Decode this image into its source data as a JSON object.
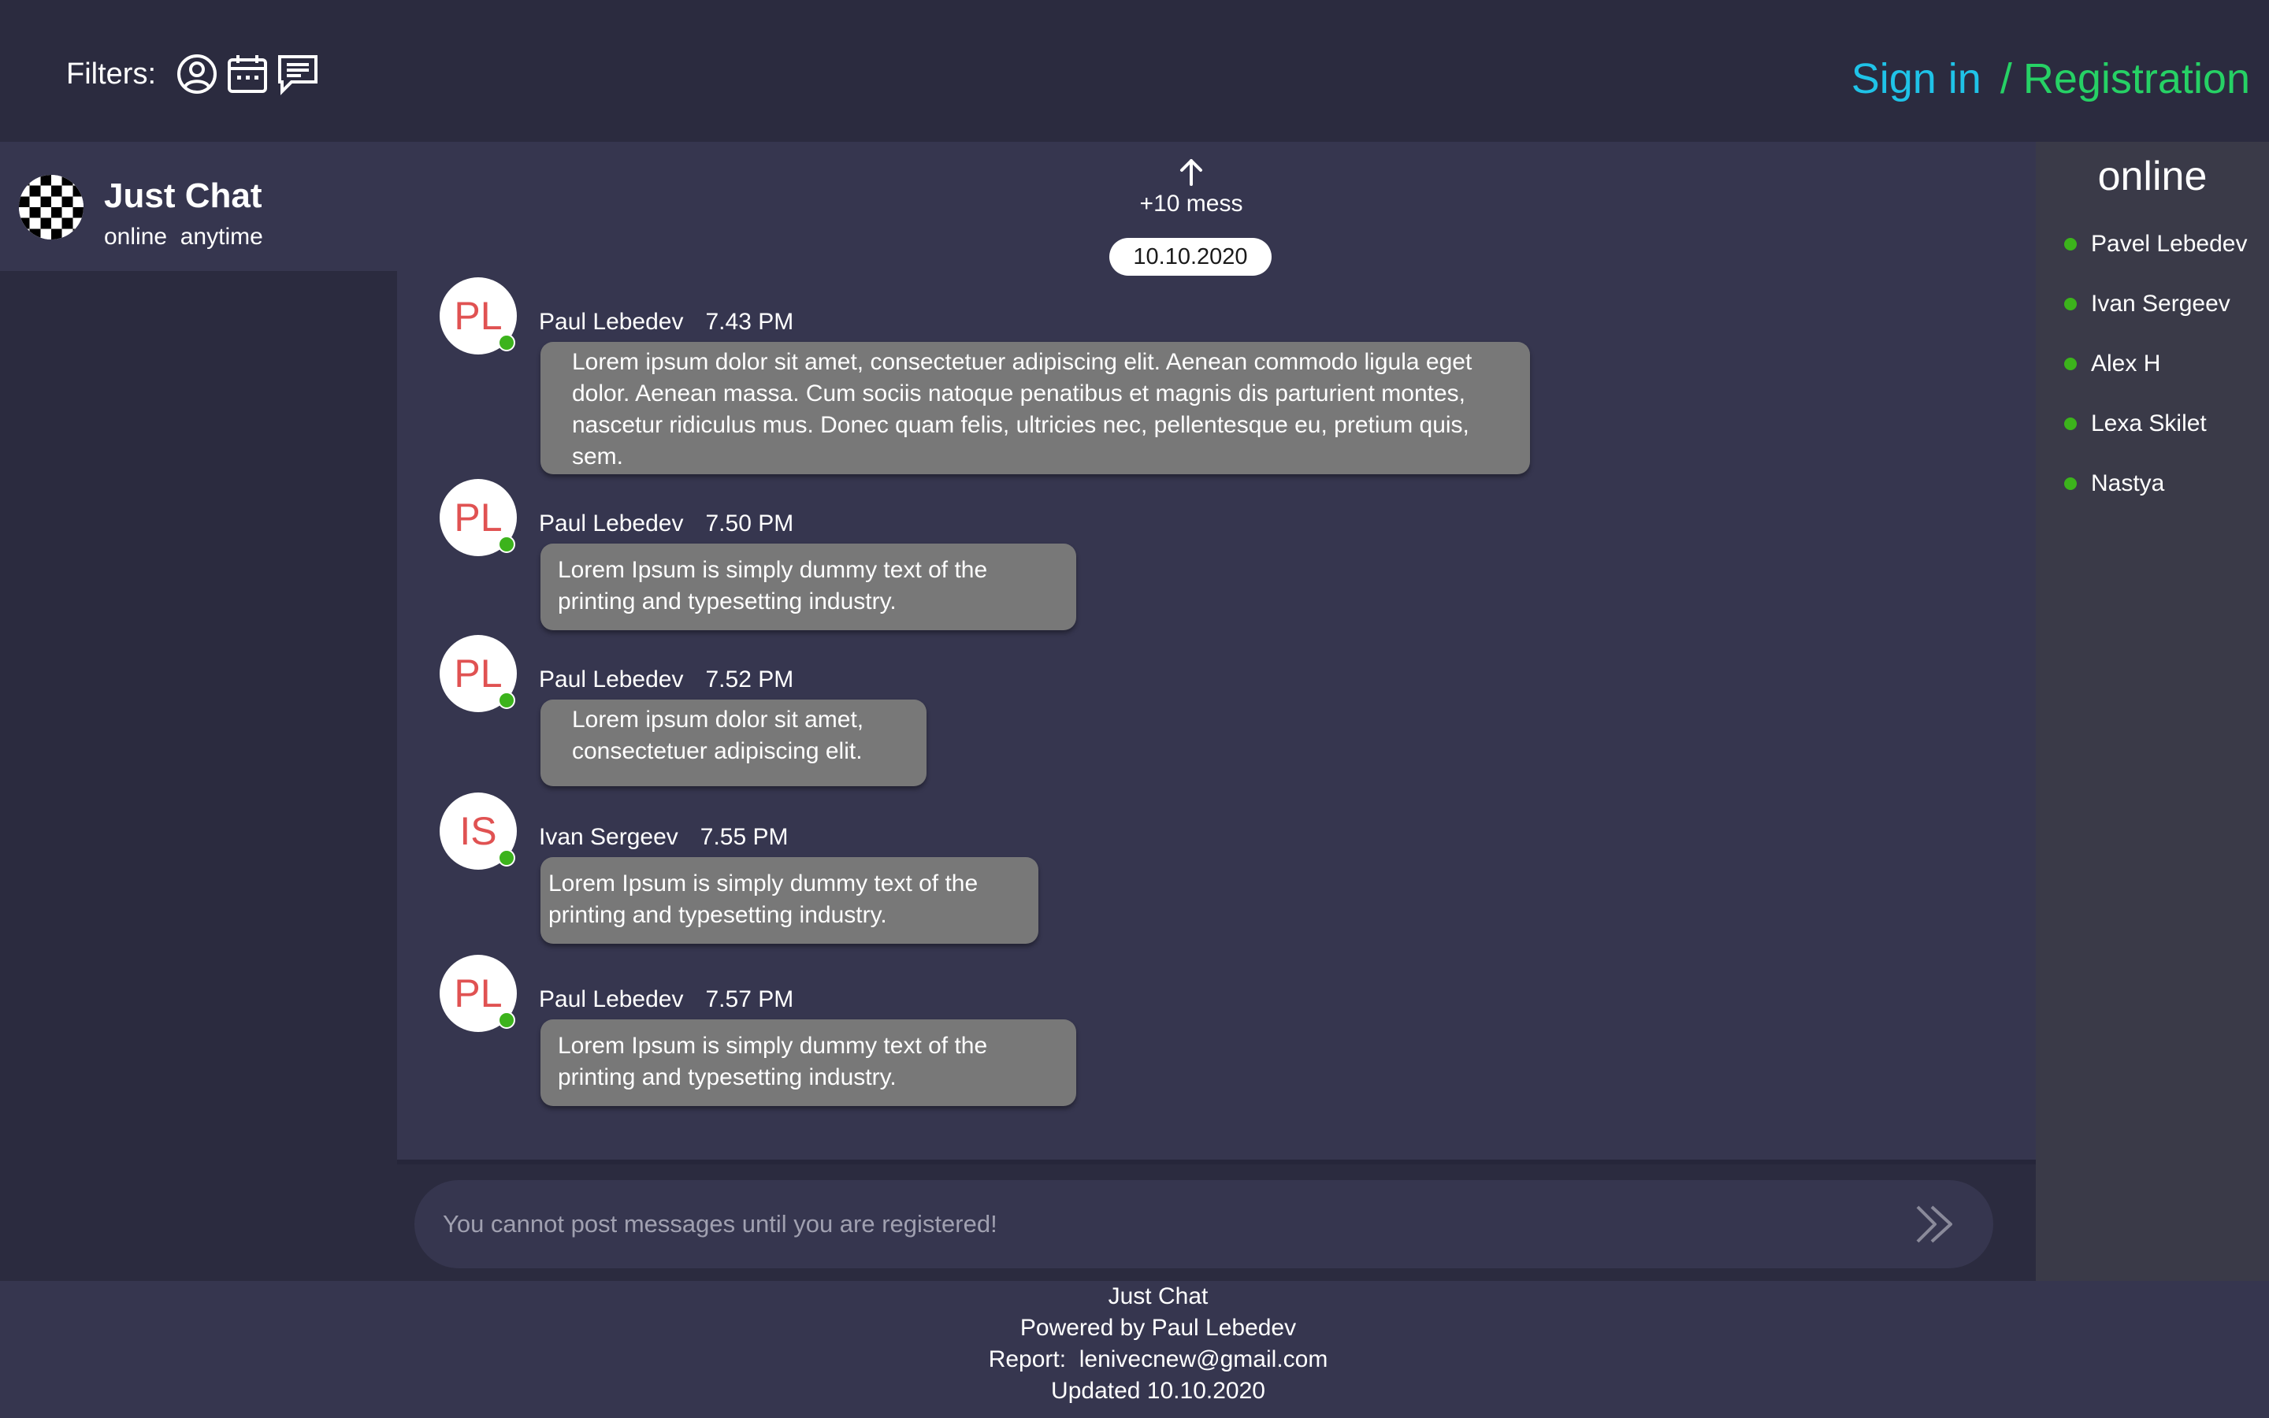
{
  "header": {
    "filters_label": "Filters:",
    "filter_icons": [
      "user-icon",
      "calendar-icon",
      "message-icon"
    ],
    "signin_label": "Sign in",
    "separator": "/",
    "registration_label": "Registration"
  },
  "sidebar": {
    "chat": {
      "title": "Just Chat",
      "subtitle": "online  anytime"
    }
  },
  "main": {
    "load_more_label": "+10 mess",
    "date": "10.10.2020",
    "messages": [
      {
        "initials": "PL",
        "author": "Paul Lebedev",
        "time": "7.43 PM",
        "text": "Lorem ipsum dolor sit amet, consectetuer adipiscing elit. Aenean commodo ligula eget dolor. Aenean massa. Cum sociis natoque penatibus et magnis dis parturient montes, nascetur ridiculus mus. Donec quam felis, ultricies nec, pellentesque eu, pretium quis, sem.",
        "online": true
      },
      {
        "initials": "PL",
        "author": "Paul Lebedev",
        "time": "7.50 PM",
        "text": "Lorem Ipsum is simply dummy text of the printing and typesetting industry.",
        "online": true
      },
      {
        "initials": "PL",
        "author": "Paul Lebedev",
        "time": "7.52 PM",
        "text": "Lorem ipsum dolor sit amet, consectetuer adipiscing elit.",
        "online": true
      },
      {
        "initials": "IS",
        "author": "Ivan Sergeev",
        "time": "7.55 PM",
        "text": "Lorem Ipsum is simply dummy text of the printing and typesetting industry.",
        "online": true
      },
      {
        "initials": "PL",
        "author": "Paul Lebedev",
        "time": "7.57 PM",
        "text": "Lorem Ipsum is simply dummy text of the printing and typesetting industry.",
        "online": true
      }
    ],
    "composer": {
      "placeholder": "You cannot post messages until you are registered!"
    }
  },
  "online": {
    "title": "online",
    "users": [
      "Pavel Lebedev",
      "Ivan Sergeev",
      "Alex H",
      "Lexa Skilet",
      "Nastya"
    ]
  },
  "footer": {
    "lines": [
      "Just Chat",
      "Powered by Paul Lebedev",
      "Report:  lenivecnew@gmail.com",
      "Updated 10.10.2020"
    ]
  },
  "colors": {
    "background": "#2b2b3f",
    "panel": "#36364f",
    "online_panel": "#3a3a48",
    "bubble": "#787878",
    "signin": "#1fc3e8",
    "registration": "#26d165",
    "avatar_text": "#e05252",
    "online_dot": "#3cb31c"
  }
}
